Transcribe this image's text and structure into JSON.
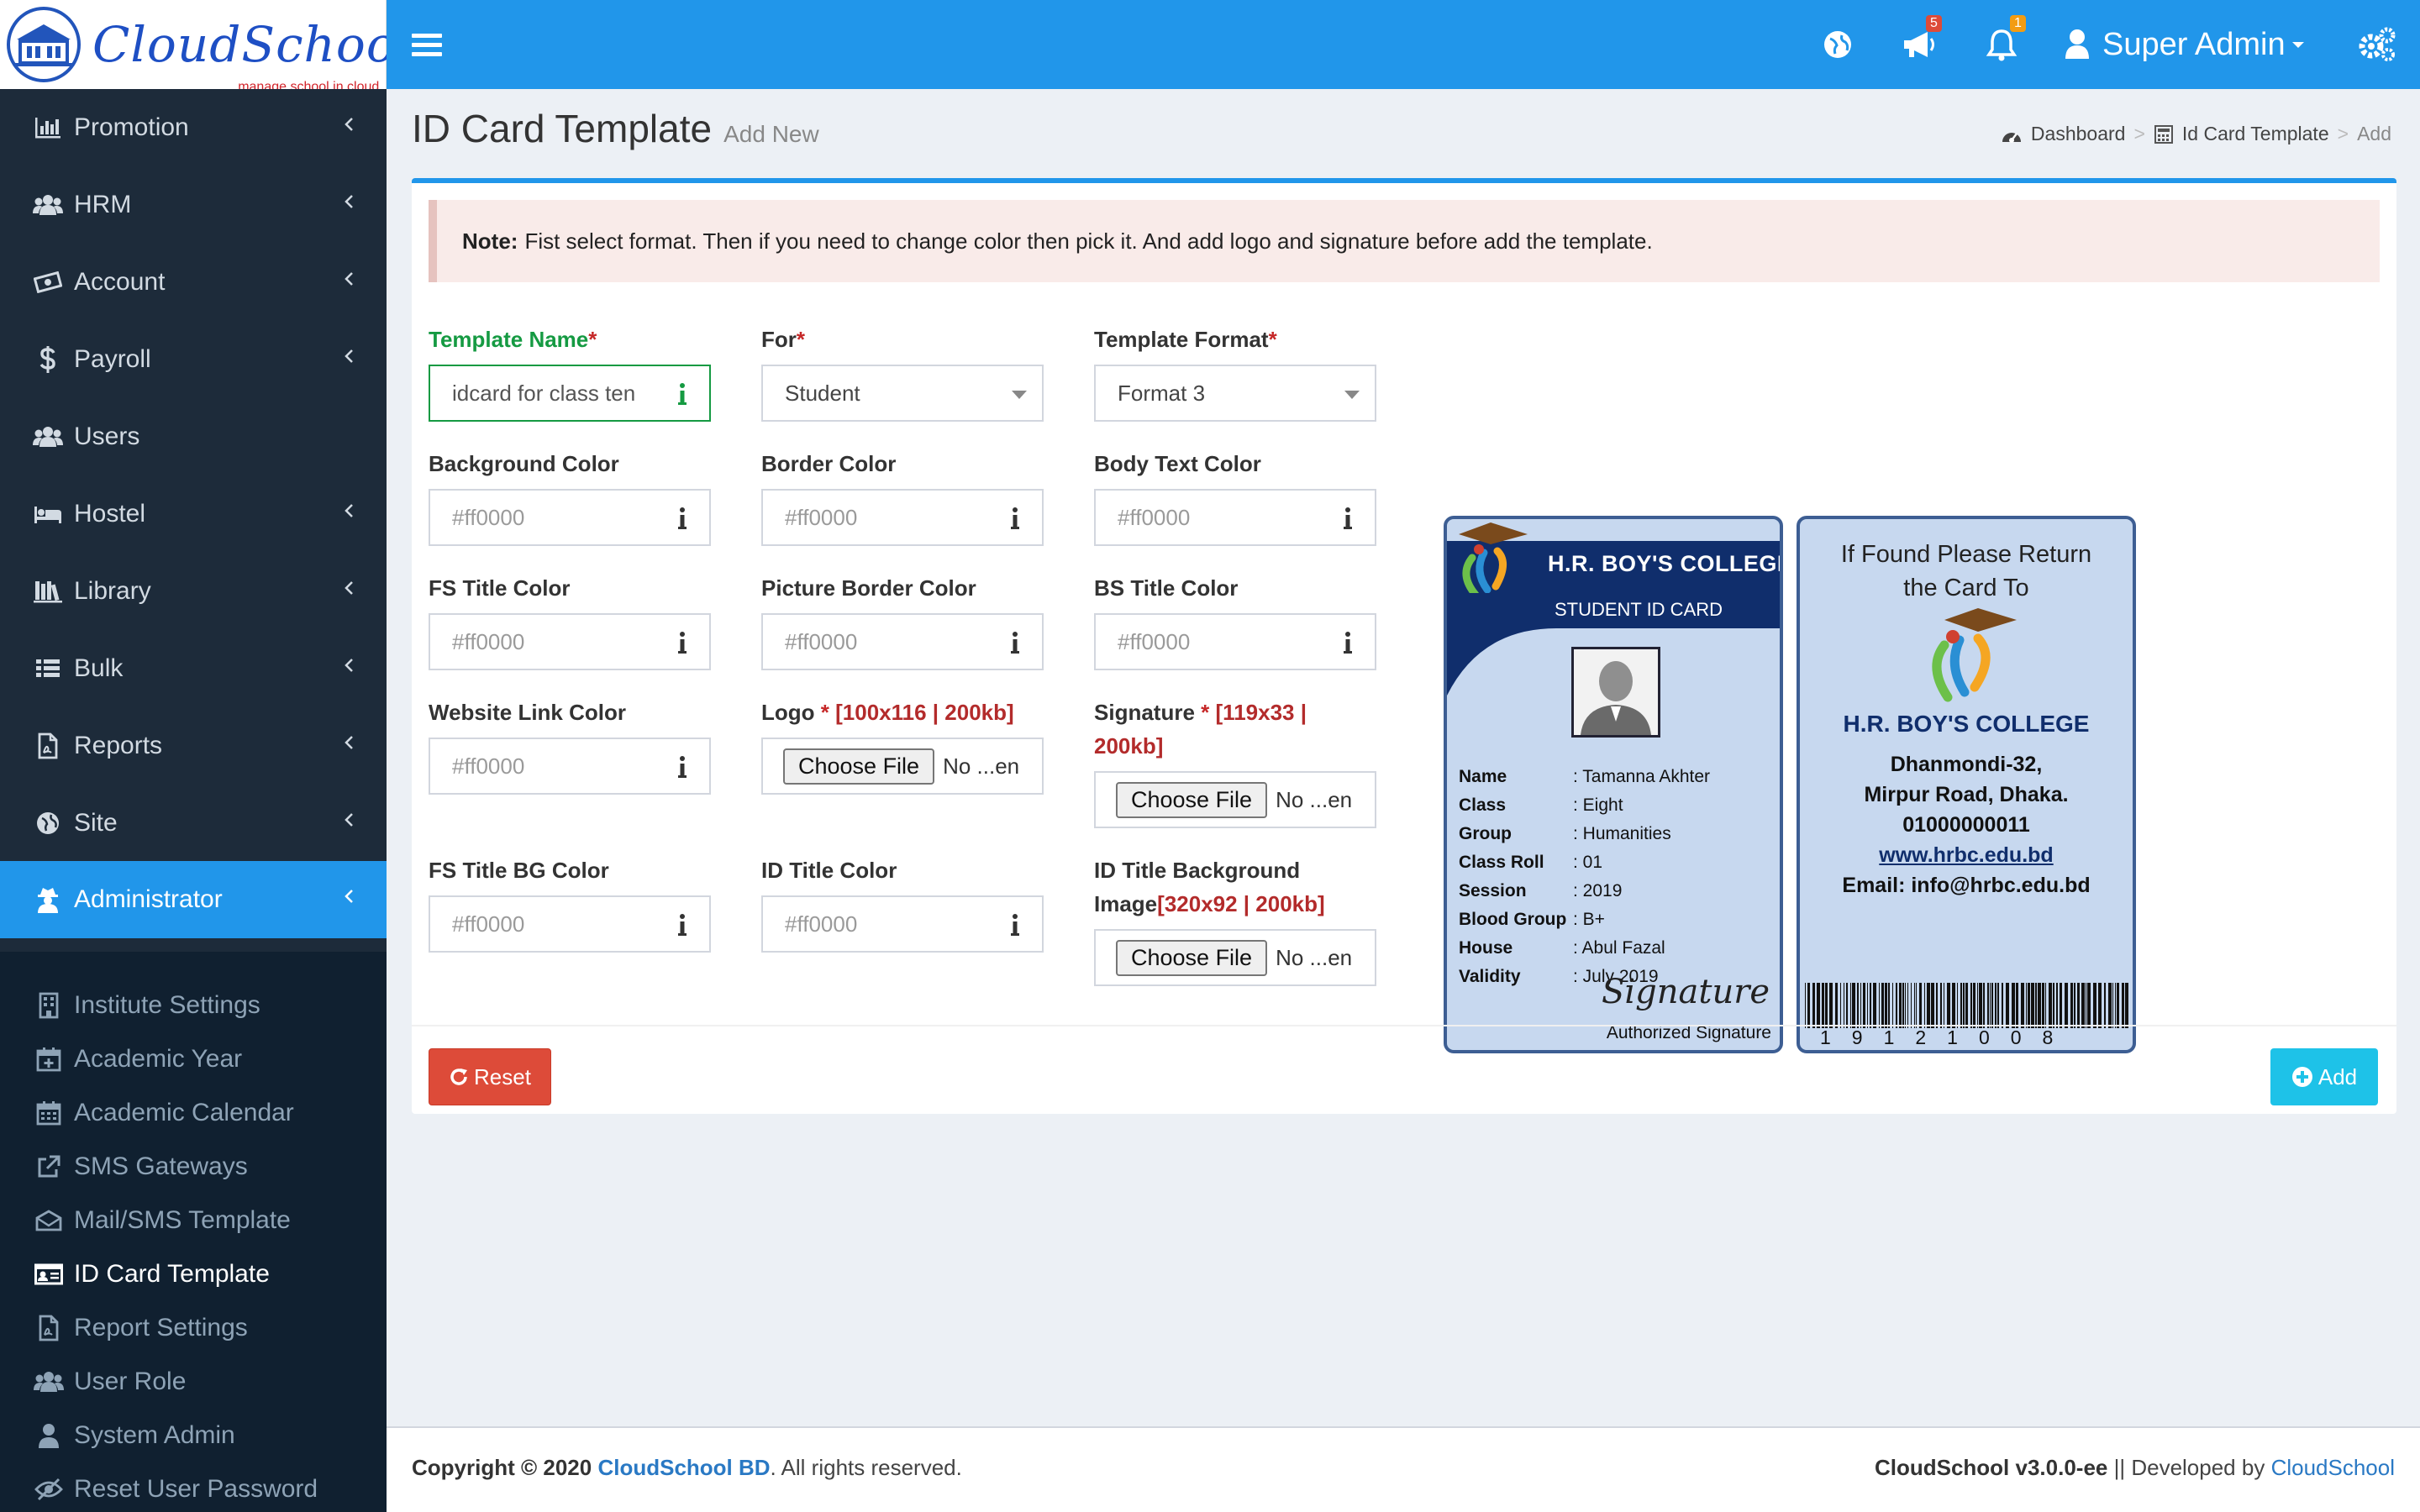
{
  "brand": {
    "name": "CloudSchool",
    "tagline": "manage school in cloud"
  },
  "header": {
    "user_name": "Super Admin",
    "announcement_count": "5",
    "notification_count": "1",
    "icons": [
      "globe-icon",
      "megaphone-icon",
      "bell-icon",
      "user-icon",
      "gears-icon"
    ]
  },
  "sidebar": {
    "items": [
      {
        "label": "Promotion",
        "icon": "bar-chart-icon"
      },
      {
        "label": "HRM",
        "icon": "users-icon"
      },
      {
        "label": "Account",
        "icon": "money-icon"
      },
      {
        "label": "Payroll",
        "icon": "dollar-icon"
      },
      {
        "label": "Users",
        "icon": "users-icon"
      },
      {
        "label": "Hostel",
        "icon": "bed-icon"
      },
      {
        "label": "Library",
        "icon": "books-icon"
      },
      {
        "label": "Bulk",
        "icon": "list-icon"
      },
      {
        "label": "Reports",
        "icon": "file-icon"
      },
      {
        "label": "Site",
        "icon": "globe-icon"
      },
      {
        "label": "Administrator",
        "icon": "user-secret-icon",
        "active": true
      }
    ],
    "sub_items": [
      {
        "label": "Institute Settings",
        "icon": "building-icon"
      },
      {
        "label": "Academic Year",
        "icon": "calendar-plus-icon"
      },
      {
        "label": "Academic Calendar",
        "icon": "calendar-icon"
      },
      {
        "label": "SMS Gateways",
        "icon": "external-link-icon"
      },
      {
        "label": "Mail/SMS Template",
        "icon": "envelope-icon"
      },
      {
        "label": "ID Card Template",
        "icon": "id-card-icon",
        "current": true
      },
      {
        "label": "Report Settings",
        "icon": "file-icon"
      },
      {
        "label": "User Role",
        "icon": "users-icon"
      },
      {
        "label": "System Admin",
        "icon": "user-icon"
      },
      {
        "label": "Reset User Password",
        "icon": "eye-slash-icon"
      }
    ]
  },
  "page": {
    "title": "ID Card Template",
    "subtitle": "Add New",
    "breadcrumb": [
      "Dashboard",
      "Id Card Template",
      "Add"
    ]
  },
  "note": {
    "label": "Note:",
    "text": "Fist select format. Then if you need to change color then pick it. And add logo and signature before add the template."
  },
  "form": {
    "template_name": {
      "label": "Template Name",
      "value": "idcard for class ten"
    },
    "for": {
      "label": "For",
      "value": "Student"
    },
    "template_format": {
      "label": "Template Format",
      "value": "Format 3"
    },
    "background_color": {
      "label": "Background Color",
      "placeholder": "#ff0000"
    },
    "border_color": {
      "label": "Border Color",
      "placeholder": "#ff0000"
    },
    "body_text_color": {
      "label": "Body Text Color",
      "placeholder": "#ff0000"
    },
    "fs_title_color": {
      "label": "FS Title Color",
      "placeholder": "#ff0000"
    },
    "picture_border_color": {
      "label": "Picture Border Color",
      "placeholder": "#ff0000"
    },
    "bs_title_color": {
      "label": "BS Title Color",
      "placeholder": "#ff0000"
    },
    "website_link_color": {
      "label": "Website Link Color",
      "placeholder": "#ff0000"
    },
    "logo": {
      "label": "Logo",
      "hint": "[100x116 | 200kb]"
    },
    "signature": {
      "label": "Signature",
      "hint_1": "[119x33 |",
      "hint_2": "200kb]"
    },
    "fs_title_bg_color": {
      "label": "FS Title BG Color",
      "placeholder": "#ff0000"
    },
    "id_title_color": {
      "label": "ID Title Color",
      "placeholder": "#ff0000"
    },
    "id_title_bg_image": {
      "label_1": "ID Title Background",
      "label_2": "Image",
      "hint": "[320x92 | 200kb]"
    },
    "file_button": "Choose File",
    "no_file": "No ...en",
    "required_mark": "*",
    "reset_button": "Reset",
    "add_button": "Add"
  },
  "card_front": {
    "college": "H.R. BOY'S COLLEGE",
    "id_title": "STUDENT ID CARD",
    "rows": [
      {
        "k": "Name",
        "v": ": Tamanna Akhter"
      },
      {
        "k": "Class",
        "v": ": Eight"
      },
      {
        "k": "Group",
        "v": ": Humanities"
      },
      {
        "k": "Class Roll",
        "v": ": 01"
      },
      {
        "k": "Session",
        "v": ": 2019"
      },
      {
        "k": "Blood Group",
        "v": ": B+"
      },
      {
        "k": "House",
        "v": ": Abul Fazal"
      },
      {
        "k": "Validity",
        "v": ": July 2019"
      }
    ],
    "signature": "Signature",
    "signature_label": "Authorized Signature"
  },
  "card_back": {
    "found_line_1": "If Found Please Return",
    "found_line_2": "the Card To",
    "college": "H.R. BOY'S COLLEGE",
    "address_1": "Dhanmondi-32,",
    "address_2": "Mirpur Road, Dhaka.",
    "phone": "01000000011",
    "website": "www.hrbc.edu.bd",
    "email": "Email: info@hrbc.edu.bd",
    "barcode_digits": "19121008"
  },
  "footer": {
    "copyright_prefix": "Copyright © 2020",
    "company": "CloudSchool BD",
    "rights": ". All rights reserved.",
    "version": "CloudSchool v3.0.0-ee",
    "developed_by": " || Developed by ",
    "developer": "CloudSchool"
  },
  "colors": {
    "primary": "#2196ea",
    "sidebar": "#1d2b3a",
    "danger": "#dd4b39",
    "info": "#1ec2e8",
    "card_navy": "#102e6c"
  }
}
